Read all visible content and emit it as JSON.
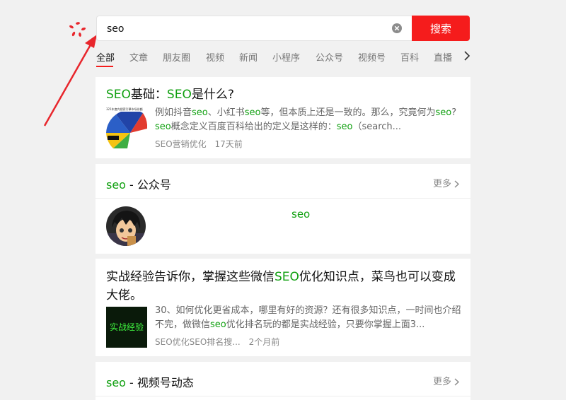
{
  "search": {
    "query": "seo",
    "button_label": "搜索"
  },
  "tabs": [
    "全部",
    "文章",
    "朋友圈",
    "视频",
    "新闻",
    "小程序",
    "公众号",
    "视频号",
    "百科",
    "直播"
  ],
  "results": {
    "article1": {
      "title_a": "SEO",
      "title_b": "基础：",
      "title_c": "SEO",
      "title_d": "是什么?",
      "thumb_caption": "321年度内搜索引擎市场份额",
      "snippet": [
        {
          "t": "例如抖音",
          "h": false
        },
        {
          "t": "seo",
          "h": true
        },
        {
          "t": "、小红书",
          "h": false
        },
        {
          "t": "seo",
          "h": true
        },
        {
          "t": "等，但本质上还是一致的。那么，究竟何为",
          "h": false
        },
        {
          "t": "seo",
          "h": true
        },
        {
          "t": "? ",
          "h": false
        },
        {
          "t": "seo",
          "h": true
        },
        {
          "t": "概念定义百度百科给出的定义是这样的：",
          "h": false
        },
        {
          "t": "seo",
          "h": true
        },
        {
          "t": "（search...",
          "h": false
        }
      ],
      "source": "SEO营销优化",
      "time": "17天前"
    },
    "account_section": {
      "keyword": "seo",
      "label": " - 公众号",
      "more": "更多",
      "account_name": "seo"
    },
    "article2": {
      "title_a": "实战经验告诉你，掌握这些微信",
      "title_b": "SEO",
      "title_c": "优化知识点，菜鸟也可以变成大佬。",
      "thumb_text": "实战经验",
      "snippet": [
        {
          "t": "30、如何优化更省成本，哪里有好的资源？还有很多知识点，一时间也介绍不完，做微信",
          "h": false
        },
        {
          "t": "seo",
          "h": true
        },
        {
          "t": "优化排名玩的都是实战经验，只要你掌握上面3...",
          "h": false
        }
      ],
      "source": "SEO优化SEO排名搜...",
      "time": "2个月前"
    },
    "video_section": {
      "keyword": "seo",
      "label": " - 视频号动态",
      "more": "更多"
    }
  },
  "colors": {
    "accent": "#f51c1c",
    "highlight": "#10a010",
    "arrow": "#e8262c"
  }
}
